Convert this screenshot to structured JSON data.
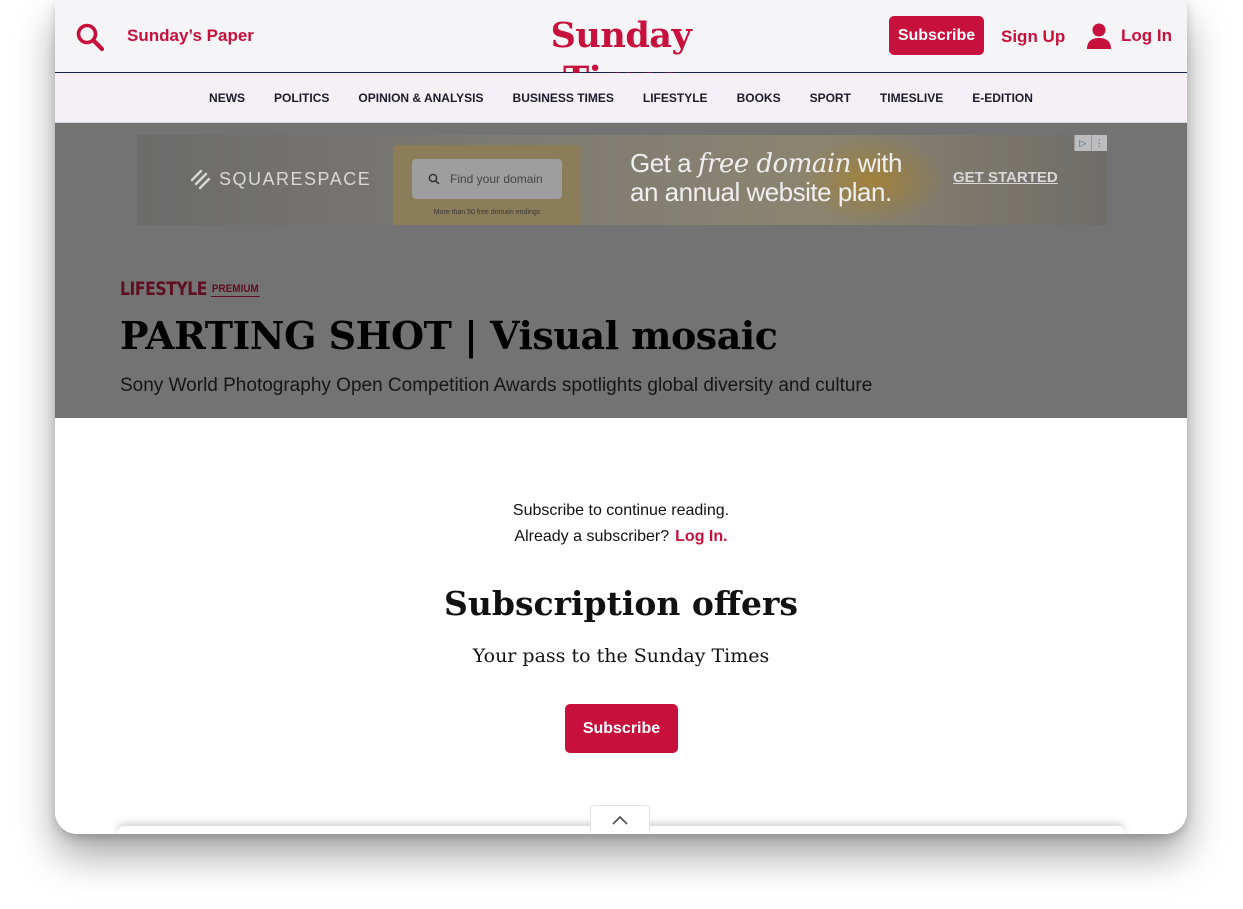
{
  "header": {
    "sundays_paper": "Sunday’s Paper",
    "logo_text": "Sunday Times",
    "subscribe_label": "Subscribe",
    "signup_label": "Sign Up",
    "login_label": "Log In"
  },
  "nav": {
    "items": [
      "NEWS",
      "POLITICS",
      "OPINION & ANALYSIS",
      "BUSINESS TIMES",
      "LIFESTYLE",
      "BOOKS",
      "SPORT",
      "TIMESLIVE",
      "E-EDITION"
    ]
  },
  "ad": {
    "brand": "SQUARESPACE",
    "search_placeholder": "Find your domain",
    "card_note": "More than 50 free domain endings",
    "headline_prefix": "Get a ",
    "headline_emphasis": "free domain",
    "headline_suffix": " with",
    "headline_line2": "an annual website plan.",
    "cta": "GET STARTED"
  },
  "article": {
    "category": "LIFESTYLE",
    "badge": "PREMIUM",
    "title": "PARTING SHOT | Visual mosaic",
    "subtitle": "Sony World Photography Open Competition Awards spotlights global diversity and culture"
  },
  "paywall": {
    "prompt": "Subscribe to continue reading.",
    "already": "Already a subscriber?",
    "login_link": "Log In.",
    "title": "Subscription offers",
    "tagline": "Your pass to the Sunday Times",
    "subscribe_label": "Subscribe"
  },
  "colors": {
    "brand_red": "#c8103c",
    "category_maroon": "#5e0f20",
    "nav_bg": "#f5f0f6",
    "overlay": "#737373"
  },
  "icons": {
    "search": "search-icon",
    "user": "user-icon",
    "collapse": "chevron-up-icon",
    "ad_choices": "adchoices-icon"
  }
}
